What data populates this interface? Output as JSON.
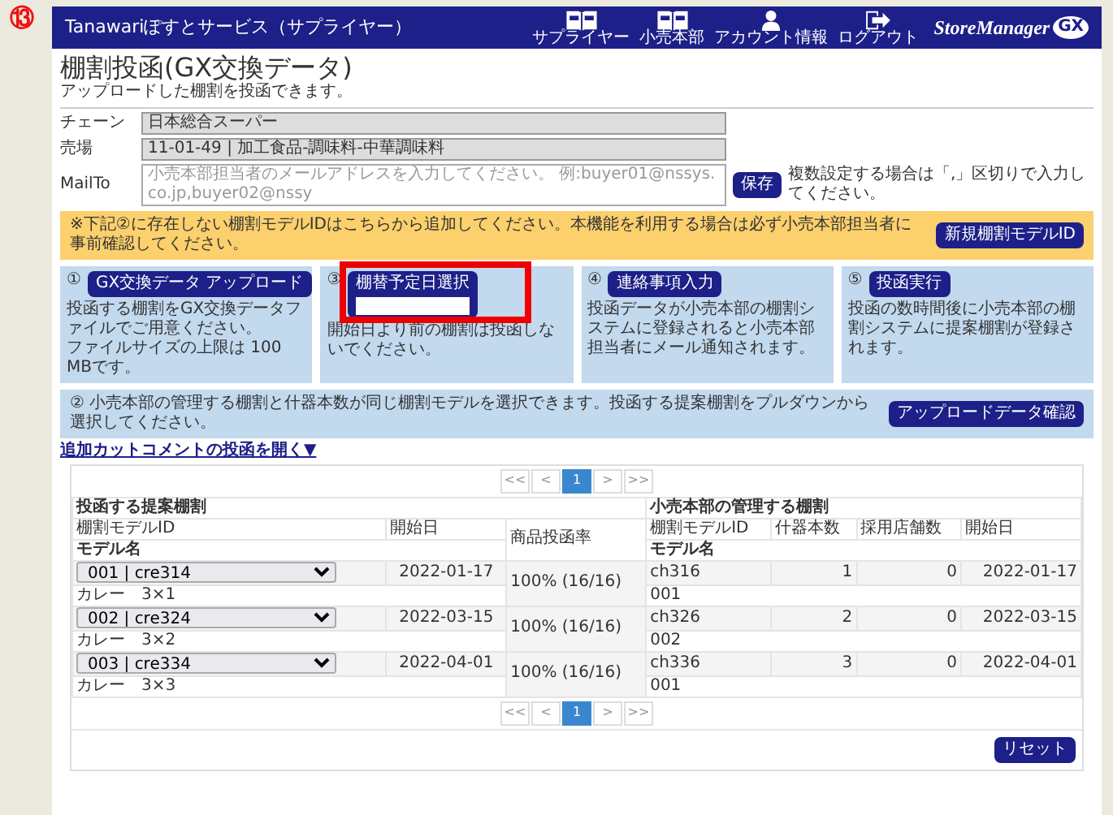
{
  "annotation": {
    "number": "⑬"
  },
  "header": {
    "title": "Tanawariぽすとサービス（サプライヤー）",
    "nav": [
      {
        "kind": "book",
        "label": "サプライヤー"
      },
      {
        "kind": "book",
        "label": "小売本部"
      },
      {
        "kind": "person",
        "label": "アカウント情報"
      },
      {
        "kind": "logout",
        "label": "ログアウト"
      }
    ],
    "logo": {
      "text": "StoreManager",
      "sub": "GX"
    }
  },
  "page": {
    "title": "棚割投函(GX交換データ)",
    "subtitle": "アップロードした棚割を投函できます。"
  },
  "form": {
    "fields": [
      {
        "label": "チェーン",
        "value": "日本総合スーパー"
      },
      {
        "label": "売場",
        "value": "11-01-49 | 加工食品-調味料-中華調味料"
      }
    ],
    "mailto": {
      "label": "MailTo",
      "placeholder": "小売本部担当者のメールアドレスを入力してください。 例:buyer01@nssys.co.jp,buyer02@nssy",
      "button": "保存",
      "hint": "複数設定する場合は「,」区切りで入力してください。"
    }
  },
  "notice": {
    "text": "※下記②に存在しない棚割モデルIDはこちらから追加してください。本機能を利用する場合は必ず小売本部担当者に事前確認してください。",
    "button": "新規棚割モデルID"
  },
  "steps": [
    {
      "number": "①",
      "button": "GX交換データ アップロード",
      "highlighted": false,
      "lines": [
        "投函する棚割をGX交換データファイルでご用意ください。",
        "ファイルサイズの上限は 100 MBです。"
      ]
    },
    {
      "number": "③",
      "button": "棚替予定日選択",
      "highlighted": true,
      "field": true,
      "lines": [
        "開始日より前の棚割は投函しないでください。"
      ]
    },
    {
      "number": "④",
      "button": "連絡事項入力",
      "highlighted": false,
      "lines": [
        "投函データが小売本部の棚割システムに登録されると小売本部担当者にメール通知されます。"
      ]
    },
    {
      "number": "⑤",
      "button": "投函実行",
      "highlighted": false,
      "lines": [
        "投函の数時間後に小売本部の棚割システムに提案棚割が登録されます。"
      ]
    }
  ],
  "step2": {
    "text": "② 小売本部の管理する棚割と什器本数が同じ棚割モデルを選択できます。投函する提案棚割をプルダウンから選択してください。",
    "button": "アップロードデータ確認"
  },
  "toggle_link": "追加カットコメントの投函を開く▼",
  "pagination_top": [
    {
      "label": "<<",
      "selected": false
    },
    {
      "label": "<",
      "selected": false
    },
    {
      "label": "1",
      "selected": true
    },
    {
      "label": ">",
      "selected": false
    },
    {
      "label": ">>",
      "selected": false
    }
  ],
  "table": {
    "groups": [
      "投函する提案棚割",
      "小売本部の管理する棚割"
    ],
    "columns": [
      "棚割モデルID",
      "開始日",
      "商品投函率",
      "棚割モデルID",
      "什器本数",
      "採用店舗数",
      "開始日"
    ],
    "subcolumns": [
      "モデル名",
      "モデル名"
    ],
    "rows": [
      {
        "model": "001 | cre314",
        "start": "2022-01-17",
        "name": "カレー　3×1",
        "rate": "100% (16/16)",
        "hq_model": "ch316",
        "fixtures": "1",
        "stores": "0",
        "hq_start": "2022-01-17",
        "hq_name": "001"
      },
      {
        "model": "002 | cre324",
        "start": "2022-03-15",
        "name": "カレー　3×2",
        "rate": "100% (16/16)",
        "hq_model": "ch326",
        "fixtures": "2",
        "stores": "0",
        "hq_start": "2022-03-15",
        "hq_name": "002"
      },
      {
        "model": "003 | cre334",
        "start": "2022-04-01",
        "name": "カレー　3×3",
        "rate": "100% (16/16)",
        "hq_model": "ch336",
        "fixtures": "3",
        "stores": "0",
        "hq_start": "2022-04-01",
        "hq_name": "001"
      }
    ]
  },
  "pagination_bottom": [
    {
      "label": "<<",
      "selected": false
    },
    {
      "label": "<",
      "selected": false
    },
    {
      "label": "1",
      "selected": true
    },
    {
      "label": ">",
      "selected": false
    },
    {
      "label": ">>",
      "selected": false
    }
  ],
  "reset_button": "リセット"
}
